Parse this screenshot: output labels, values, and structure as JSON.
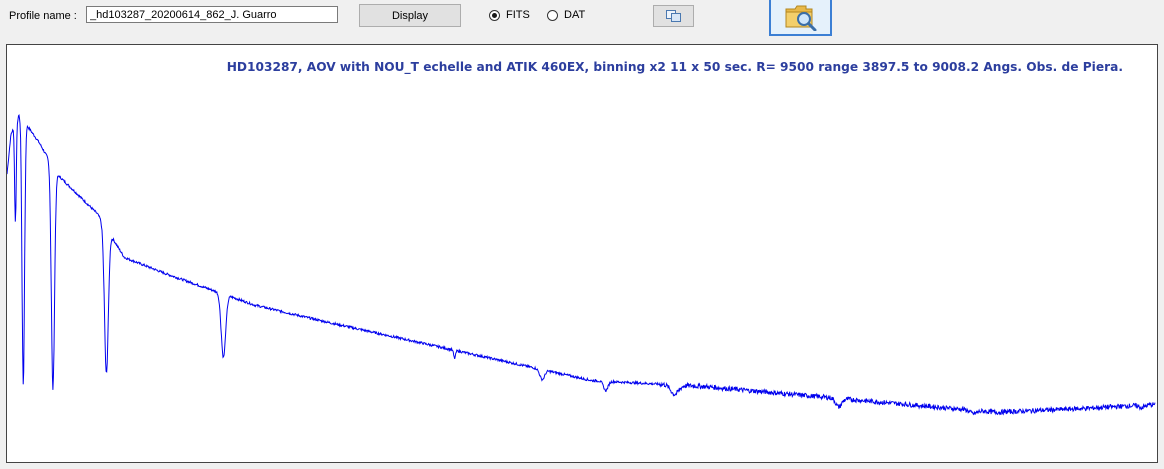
{
  "toolbar": {
    "profile_label": "Profile name :",
    "profile_value": "_hd103287_20200614_862_J. Guarro",
    "display_label": "Display",
    "format_options": [
      {
        "label": "FITS",
        "selected": true
      },
      {
        "label": "DAT",
        "selected": false
      }
    ],
    "copy_icon": "copy-icon",
    "open_icon": "folder-search-icon"
  },
  "plot": {
    "title": "HD103287, AOV with NOU_T echelle and ATIK 460EX, binning x2  11 x 50 sec.  R= 9500 range 3897.5 to 9008.2 Angs. Obs. de Piera.",
    "line_color": "#0000ee",
    "title_color": "#2c3e9e"
  },
  "chart_data": {
    "type": "line",
    "title": "HD103287, AOV with NOU_T echelle and ATIK 460EX, binning x2  11 x 50 sec.  R= 9500 range 3897.5 to 9008.2 Angs. Obs. de Piera.",
    "xlabel": "",
    "ylabel": "",
    "xlim": [
      3897.5,
      9008.2
    ],
    "ylim": [
      0,
      1
    ],
    "grid": false,
    "continuum": {
      "x": [
        3897.5,
        3915,
        3960,
        3990,
        4040,
        4120,
        4300,
        4420,
        4600,
        4800,
        5000,
        5300,
        5700,
        6100,
        6500,
        7000,
        7500,
        7900,
        8300,
        8700,
        9008.2
      ],
      "y": [
        0.7,
        0.8,
        0.86,
        0.82,
        0.78,
        0.7,
        0.6,
        0.49,
        0.45,
        0.41,
        0.37,
        0.33,
        0.28,
        0.23,
        0.18,
        0.165,
        0.14,
        0.12,
        0.1,
        0.11,
        0.12
      ]
    },
    "absorption_features": [
      {
        "x": 3935,
        "width": 5,
        "depth": 0.3
      },
      {
        "x": 3970,
        "width": 8,
        "depth": 0.8
      },
      {
        "x": 4102,
        "width": 10,
        "depth": 0.78
      },
      {
        "x": 4340,
        "width": 12,
        "depth": 0.65
      },
      {
        "x": 4861,
        "width": 14,
        "depth": 0.4
      },
      {
        "x": 5890,
        "width": 6,
        "depth": 0.08
      },
      {
        "x": 6280,
        "width": 15,
        "depth": 0.12
      },
      {
        "x": 6563,
        "width": 14,
        "depth": 0.13
      },
      {
        "x": 6870,
        "width": 25,
        "depth": 0.14
      },
      {
        "x": 7600,
        "width": 18,
        "depth": 0.16
      },
      {
        "x": 8200,
        "width": 22,
        "depth": 0.08
      },
      {
        "x": 8950,
        "width": 20,
        "depth": 0.05
      }
    ]
  }
}
